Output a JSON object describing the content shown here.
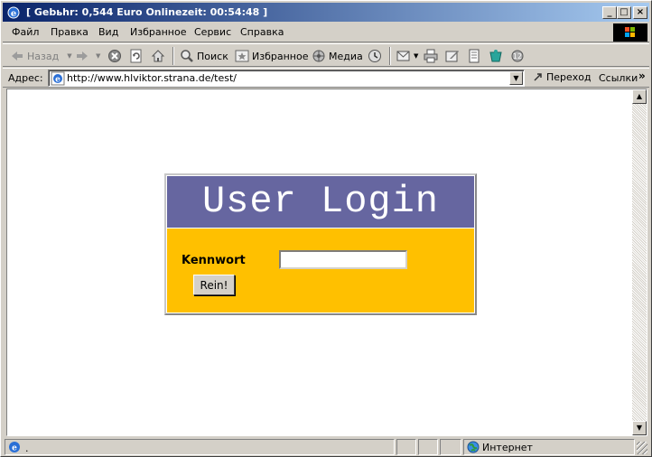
{
  "window": {
    "title": "[ Gebьhr: 0,544 Euro Onlinezeit: 00:54:48 ]",
    "controls": {
      "minimize": "_",
      "maximize": "□",
      "close": "×"
    }
  },
  "menubar": {
    "items": [
      {
        "label": "Файл"
      },
      {
        "label": "Правка"
      },
      {
        "label": "Вид"
      },
      {
        "label": "Избранное"
      },
      {
        "label": "Сервис"
      },
      {
        "label": "Справка"
      }
    ]
  },
  "toolbar": {
    "back_label": "Назад",
    "search_label": "Поиск",
    "favorites_label": "Избранное",
    "media_label": "Медиа"
  },
  "addressbar": {
    "label": "Адрес:",
    "url": "http://www.hlviktor.strana.de/test/",
    "go_label": "Переход",
    "links_label": "Ссылки",
    "links_chevron": "»"
  },
  "page": {
    "login_title": "User Login",
    "password_label": "Kennwort",
    "password_value": "",
    "submit_label": "Rein!"
  },
  "statusbar": {
    "status_text": ".",
    "zone_text": "Интернет"
  },
  "colors": {
    "login_header_bg": "#6666a0",
    "login_body_bg": "#ffc000",
    "titlebar_start": "#0a246a",
    "titlebar_end": "#a6caf0"
  }
}
